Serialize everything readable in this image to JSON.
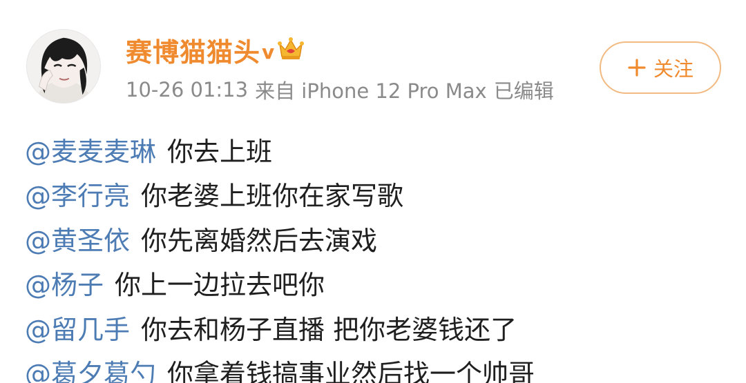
{
  "header": {
    "username": "赛博猫猫头",
    "vip_badge": "v",
    "crown_icon": "crown-icon",
    "timestamp": "10-26 01:13",
    "source": "来自 iPhone 12 Pro Max",
    "edited": "已编辑",
    "follow_label": "关注",
    "username_color": "#f08a2e",
    "mention_color": "#4d7cb4"
  },
  "lines": [
    {
      "mention": "@麦麦麦琳",
      "text": "你去上班"
    },
    {
      "mention": "@李行亮",
      "text": "你老婆上班你在家写歌"
    },
    {
      "mention": "@黄圣依",
      "text": "你先离婚然后去演戏"
    },
    {
      "mention": "@杨子",
      "text": "你上一边拉去吧你"
    },
    {
      "mention": "@留几手",
      "text": "你去和杨子直播 把你老婆钱还了"
    },
    {
      "mention": "@葛夕葛勺",
      "text": "你拿着钱搞事业然后找一个帅哥"
    }
  ]
}
